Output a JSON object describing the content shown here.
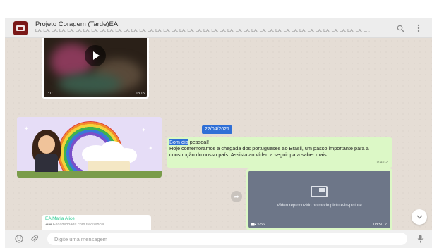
{
  "header": {
    "group_name": "Projeto Coragem (Tarde)EA",
    "members": "EA, EA, EA, EA, EA, EA, EA, EA, EA, EA, EA, EA, EA, EA, EA, EA, EA, EA, EA, EA, EA, EA, EA, EA, EA, EA, EA, EA, EA, EA, EA, EA, EA, EA, EA, EA, EA, EA, EA, EA, EA, E...",
    "search_icon": "search-icon",
    "menu_icon": "menu-icon"
  },
  "chat": {
    "top_video": {
      "duration": "1:07",
      "time": "13:15"
    },
    "date_divider": "22/04/2021",
    "text_message": {
      "highlight": "Bom dia",
      "rest": " pessoal!\nHoje comemoramos a chegada dos portugueses ao Brasil, um passo importante para a construção do nosso país. Assista ao vídeo a seguir para saber mais.",
      "time": "08:49 ✓"
    },
    "video_message": {
      "overlay_text": "Vídeo reproduzido no modo picture-in-picture",
      "duration": "5:56",
      "time": "08:50 ✓"
    },
    "incoming": {
      "sender": "EA Maria Alice",
      "forwarded": "Encaminhada com frequência"
    }
  },
  "footer": {
    "placeholder": "Digite uma mensagem",
    "emoji_icon": "emoji-icon",
    "attach_icon": "attach-icon",
    "mic_icon": "mic-icon"
  },
  "colors": {
    "chat_bg": "#e5ddd5",
    "outgoing_bubble": "#dcf8c6",
    "highlight": "#2f6fd6",
    "sender_name": "#35cd96"
  }
}
